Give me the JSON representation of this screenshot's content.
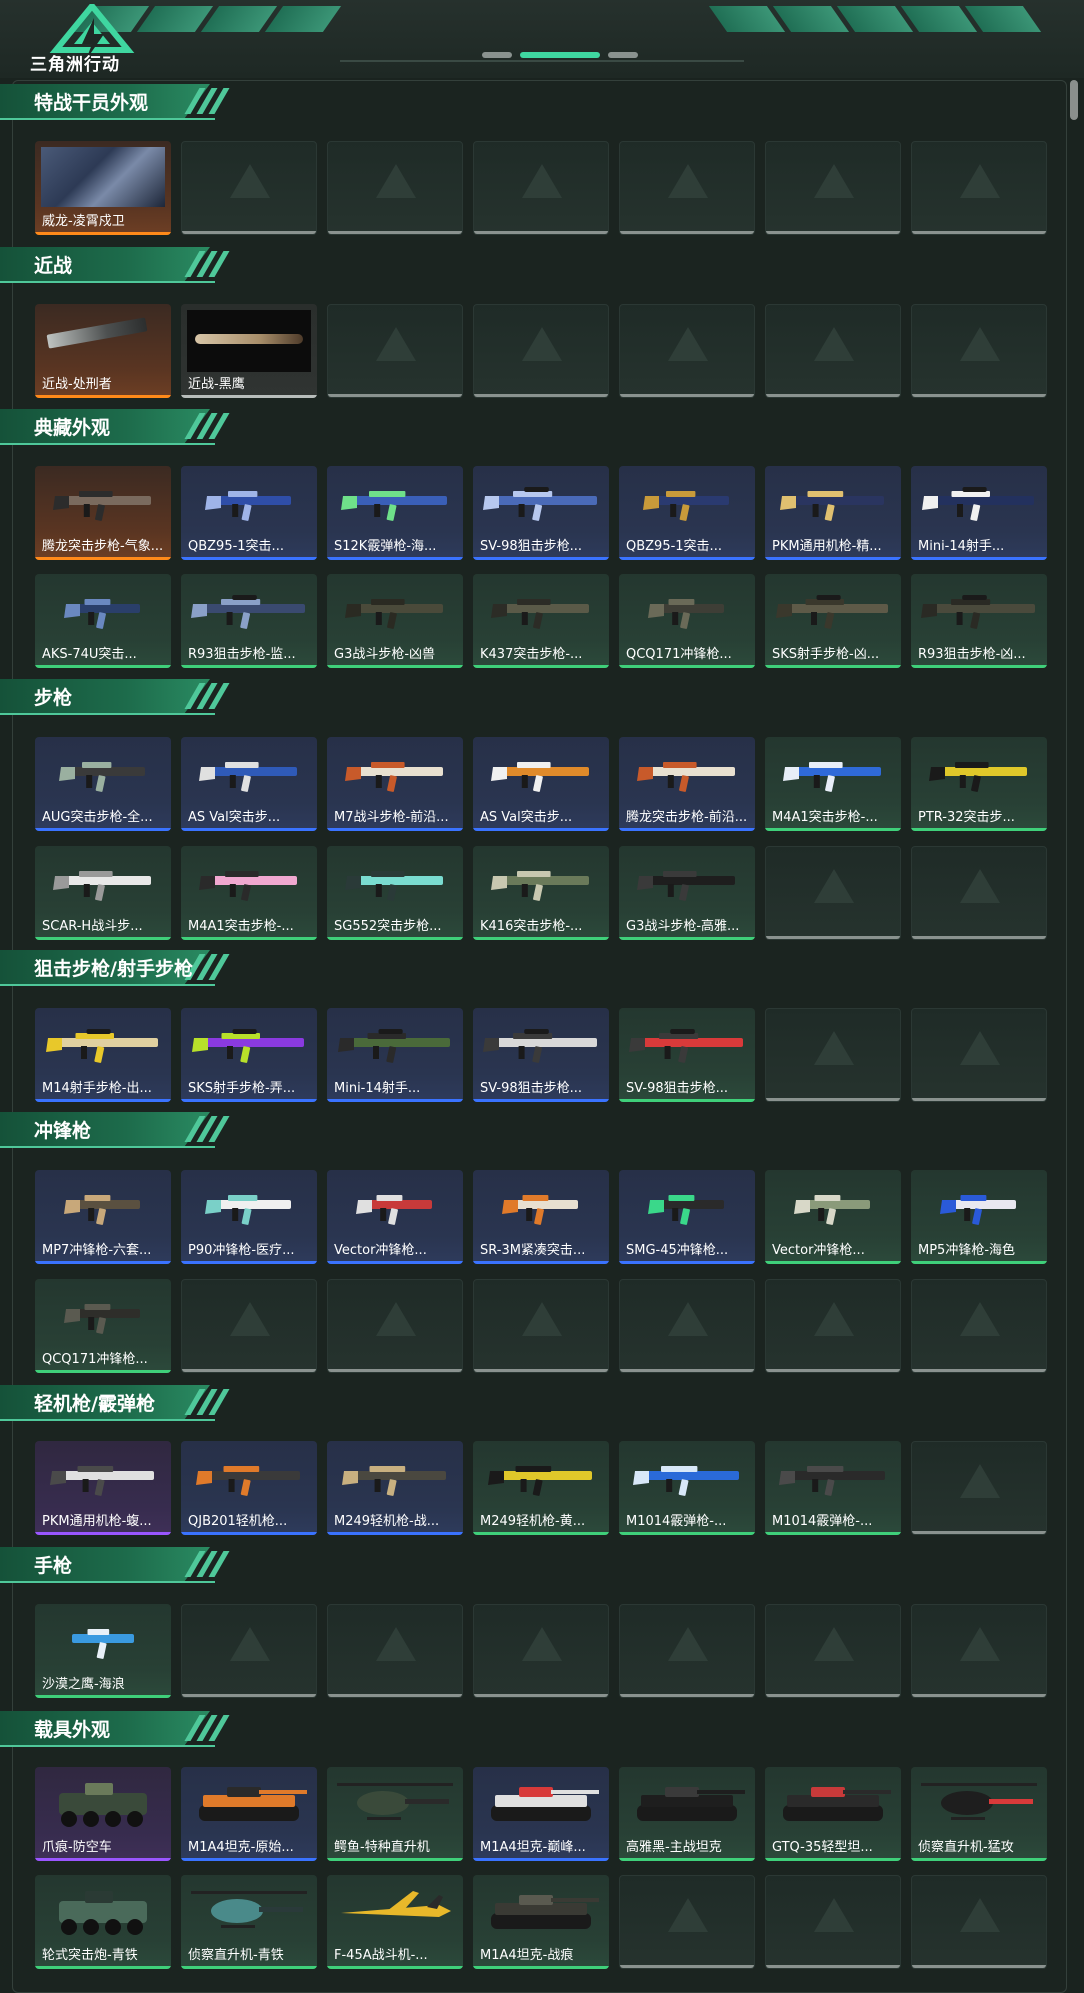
{
  "app": {
    "logo_text": "三角洲行动"
  },
  "sections": [
    {
      "title": "特战干员外观",
      "rows": [
        [
          {
            "name": "威龙-凌霄戍卫",
            "rarity": "orange",
            "art": "operator"
          },
          null,
          null,
          null,
          null,
          null,
          null
        ]
      ]
    },
    {
      "title": "近战",
      "rows": [
        [
          {
            "name": "近战-处刑者",
            "rarity": "orange",
            "art": "knife1"
          },
          {
            "name": "近战-黑鹰",
            "rarity": "gray",
            "art": "knife2"
          },
          null,
          null,
          null,
          null,
          null
        ]
      ]
    },
    {
      "title": "典藏外观",
      "rows": [
        [
          {
            "name": "腾龙突击步枪-气象...",
            "rarity": "orange",
            "art": "rifle",
            "c1": "#7a6a5e",
            "c2": "#2c2c2c"
          },
          {
            "name": "QBZ95-1突击...",
            "rarity": "blue",
            "art": "bullpup",
            "c1": "#2f4ea8",
            "c2": "#9fb4e8"
          },
          {
            "name": "S12K霰弹枪-海...",
            "rarity": "blue",
            "art": "shotgun",
            "c1": "#3a5fb8",
            "c2": "#6fe08a"
          },
          {
            "name": "SV-98狙击步枪...",
            "rarity": "blue",
            "art": "sniper",
            "c1": "#4a6ab8",
            "c2": "#b7c8ef"
          },
          {
            "name": "QBZ95-1突击...",
            "rarity": "blue",
            "art": "bullpup",
            "c1": "#2a3a70",
            "c2": "#c89a3a"
          },
          {
            "name": "PKM通用机枪-精...",
            "rarity": "blue",
            "art": "lmg",
            "c1": "#2a3560",
            "c2": "#e0c070"
          },
          {
            "name": "Mini-14射手...",
            "rarity": "blue",
            "art": "marksman",
            "c1": "#23315e",
            "c2": "#f0f0f0"
          }
        ],
        [
          {
            "name": "AKS-74U突击...",
            "rarity": "green",
            "art": "smg",
            "c1": "#2a3f6a",
            "c2": "#6a88c0"
          },
          {
            "name": "R93狙击步枪-监...",
            "rarity": "green",
            "art": "sniper",
            "c1": "#3a4a70",
            "c2": "#8aa0c8"
          },
          {
            "name": "G3战斗步枪-凶兽",
            "rarity": "green",
            "art": "rifle",
            "c1": "#4a4a3a",
            "c2": "#2a2a22"
          },
          {
            "name": "K437突击步枪-...",
            "rarity": "green",
            "art": "rifle",
            "c1": "#5a5a48",
            "c2": "#2c2c26"
          },
          {
            "name": "QCQ171冲锋枪...",
            "rarity": "green",
            "art": "smg",
            "c1": "#3e3e36",
            "c2": "#6a6a58"
          },
          {
            "name": "SKS射手步枪-凶...",
            "rarity": "green",
            "art": "marksman",
            "c1": "#5e5a48",
            "c2": "#3a382c"
          },
          {
            "name": "R93狙击步枪-凶...",
            "rarity": "green",
            "art": "sniper",
            "c1": "#4a4a3c",
            "c2": "#2a2a24"
          }
        ]
      ]
    },
    {
      "title": "步枪",
      "rows": [
        [
          {
            "name": "AUG突击步枪-全...",
            "rarity": "blue",
            "art": "bullpup",
            "c1": "#3a3a3a",
            "c2": "#9ab0a0"
          },
          {
            "name": "AS Val突击步...",
            "rarity": "blue",
            "art": "rifle",
            "c1": "#2f5ab8",
            "c2": "#e0e0e0"
          },
          {
            "name": "M7战斗步枪-前沿...",
            "rarity": "blue",
            "art": "rifle",
            "c1": "#e8e0d0",
            "c2": "#c85a2a"
          },
          {
            "name": "AS Val突击步...",
            "rarity": "blue",
            "art": "rifle",
            "c1": "#e08a2a",
            "c2": "#f0f0f0"
          },
          {
            "name": "腾龙突击步枪-前沿...",
            "rarity": "blue",
            "art": "rifle",
            "c1": "#e8e0d0",
            "c2": "#c85a2a"
          },
          {
            "name": "M4A1突击步枪-...",
            "rarity": "green",
            "art": "rifle",
            "c1": "#2f6ad8",
            "c2": "#e8eef8"
          },
          {
            "name": "PTR-32突击步...",
            "rarity": "green",
            "art": "rifle",
            "c1": "#e0c82a",
            "c2": "#1a1a1a"
          }
        ],
        [
          {
            "name": "SCAR-H战斗步...",
            "rarity": "green",
            "art": "rifle",
            "c1": "#e8e8e8",
            "c2": "#9a9a9a"
          },
          {
            "name": "M4A1突击步枪-...",
            "rarity": "green",
            "art": "rifle",
            "c1": "#f0a8d0",
            "c2": "#2a2a2a"
          },
          {
            "name": "SG552突击步枪...",
            "rarity": "green",
            "art": "rifle",
            "c1": "#7adcd0",
            "c2": "#2a3a38"
          },
          {
            "name": "K416突击步枪-...",
            "rarity": "green",
            "art": "rifle",
            "c1": "#6a7a5a",
            "c2": "#c8c8b0"
          },
          {
            "name": "G3战斗步枪-高雅...",
            "rarity": "green",
            "art": "rifle",
            "c1": "#1e1e1e",
            "c2": "#3a3a3a"
          },
          null,
          null
        ]
      ]
    },
    {
      "title": "狙击步枪/射手步枪",
      "rows": [
        [
          {
            "name": "M14射手步枪-出...",
            "rarity": "blue",
            "art": "marksman",
            "c1": "#e0d0a0",
            "c2": "#e8c82a"
          },
          {
            "name": "SKS射手步枪-弄...",
            "rarity": "blue",
            "art": "marksman",
            "c1": "#8a3ae0",
            "c2": "#b8e02a"
          },
          {
            "name": "Mini-14射手...",
            "rarity": "blue",
            "art": "marksman",
            "c1": "#4a6a3a",
            "c2": "#2a2a2a"
          },
          {
            "name": "SV-98狙击步枪...",
            "rarity": "blue",
            "art": "sniper",
            "c1": "#d8d8d8",
            "c2": "#3a3a3a"
          },
          {
            "name": "SV-98狙击步枪...",
            "rarity": "green",
            "art": "sniper",
            "c1": "#d83a3a",
            "c2": "#3a3a3a"
          },
          null,
          null
        ]
      ]
    },
    {
      "title": "冲锋枪",
      "rows": [
        [
          {
            "name": "MP7冲锋枪-六套...",
            "rarity": "blue",
            "art": "smg",
            "c1": "#5a5040",
            "c2": "#c8a87a"
          },
          {
            "name": "P90冲锋枪-医疗...",
            "rarity": "blue",
            "art": "bullpup",
            "c1": "#f0f0f0",
            "c2": "#7ad0c8"
          },
          {
            "name": "Vector冲锋枪...",
            "rarity": "blue",
            "art": "smg",
            "c1": "#c83a3a",
            "c2": "#e0e0e0"
          },
          {
            "name": "SR-3M紧凑突击...",
            "rarity": "blue",
            "art": "smg",
            "c1": "#e8e0d0",
            "c2": "#e07a2a"
          },
          {
            "name": "SMG-45冲锋枪...",
            "rarity": "blue",
            "art": "smg",
            "c1": "#2a2a2a",
            "c2": "#3ad88a"
          },
          {
            "name": "Vector冲锋枪...",
            "rarity": "green",
            "art": "smg",
            "c1": "#8a9a7a",
            "c2": "#d8d8c8"
          },
          {
            "name": "MP5冲锋枪-海色",
            "rarity": "green",
            "art": "smg",
            "c1": "#e8e8f0",
            "c2": "#2a5ad8"
          }
        ],
        [
          {
            "name": "QCQ171冲锋枪...",
            "rarity": "green",
            "art": "smg",
            "c1": "#2e2e2a",
            "c2": "#5a5a50"
          },
          null,
          null,
          null,
          null,
          null,
          null
        ]
      ]
    },
    {
      "title": "轻机枪/霰弹枪",
      "rows": [
        [
          {
            "name": "PKM通用机枪-蝮...",
            "rarity": "purple",
            "art": "lmg",
            "c1": "#e0e0e0",
            "c2": "#4a4a4a"
          },
          {
            "name": "QJB201轻机枪...",
            "rarity": "blue",
            "art": "lmg",
            "c1": "#3a3a3a",
            "c2": "#e07a2a"
          },
          {
            "name": "M249轻机枪-战...",
            "rarity": "blue",
            "art": "lmg",
            "c1": "#4a4840",
            "c2": "#c8b080"
          },
          {
            "name": "M249轻机枪-黄...",
            "rarity": "green",
            "art": "lmg",
            "c1": "#e0c82a",
            "c2": "#1a1a1a"
          },
          {
            "name": "M1014霰弹枪-...",
            "rarity": "green",
            "art": "shotgun",
            "c1": "#2a6ad8",
            "c2": "#d8e8f8"
          },
          {
            "name": "M1014霰弹枪-...",
            "rarity": "green",
            "art": "shotgun",
            "c1": "#2a2a2a",
            "c2": "#4a4a4a"
          },
          null
        ]
      ]
    },
    {
      "title": "手枪",
      "rows": [
        [
          {
            "name": "沙漠之鹰-海浪",
            "rarity": "green",
            "art": "pistol",
            "c1": "#3a9ae0",
            "c2": "#e8f0f8"
          },
          null,
          null,
          null,
          null,
          null,
          null
        ]
      ]
    },
    {
      "title": "载具外观",
      "rows": [
        [
          {
            "name": "爪痕-防空车",
            "rarity": "purple",
            "art": "apc",
            "c1": "#3a4a3a",
            "c2": "#6a7a5a"
          },
          {
            "name": "M1A4坦克-原始...",
            "rarity": "blue",
            "art": "tank",
            "c1": "#e07a2a",
            "c2": "#2a2a2a"
          },
          {
            "name": "鳄鱼-特种直升机",
            "rarity": "green",
            "art": "heli",
            "c1": "#3a4a3a",
            "c2": "#2a2a2a"
          },
          {
            "name": "M1A4坦克-巅峰...",
            "rarity": "blue",
            "art": "tank",
            "c1": "#e0e0e0",
            "c2": "#d83a3a"
          },
          {
            "name": "高雅黑-主战坦克",
            "rarity": "green",
            "art": "tank",
            "c1": "#1e1e1e",
            "c2": "#3a3a3a"
          },
          {
            "name": "GTQ-35轻型坦...",
            "rarity": "green",
            "art": "tank",
            "c1": "#2a2a2a",
            "c2": "#c83a3a"
          },
          {
            "name": "侦察直升机-猛攻",
            "rarity": "green",
            "art": "heli",
            "c1": "#1e1e1e",
            "c2": "#d83a3a"
          }
        ],
        [
          {
            "name": "轮式突击炮-青铁",
            "rarity": "green",
            "art": "apc",
            "c1": "#4a6a5a",
            "c2": "#2a3a34"
          },
          {
            "name": "侦察直升机-青铁",
            "rarity": "green",
            "art": "heli",
            "c1": "#4a8a8a",
            "c2": "#2a3a3a"
          },
          {
            "name": "F-45A战斗机-...",
            "rarity": "green",
            "art": "jet",
            "c1": "#e8b82a",
            "c2": "#2a2a2a"
          },
          {
            "name": "M1A4坦克-战痕",
            "rarity": "green",
            "art": "tank",
            "c1": "#3a3a34",
            "c2": "#5a5a50"
          },
          null,
          null,
          null
        ]
      ]
    }
  ]
}
